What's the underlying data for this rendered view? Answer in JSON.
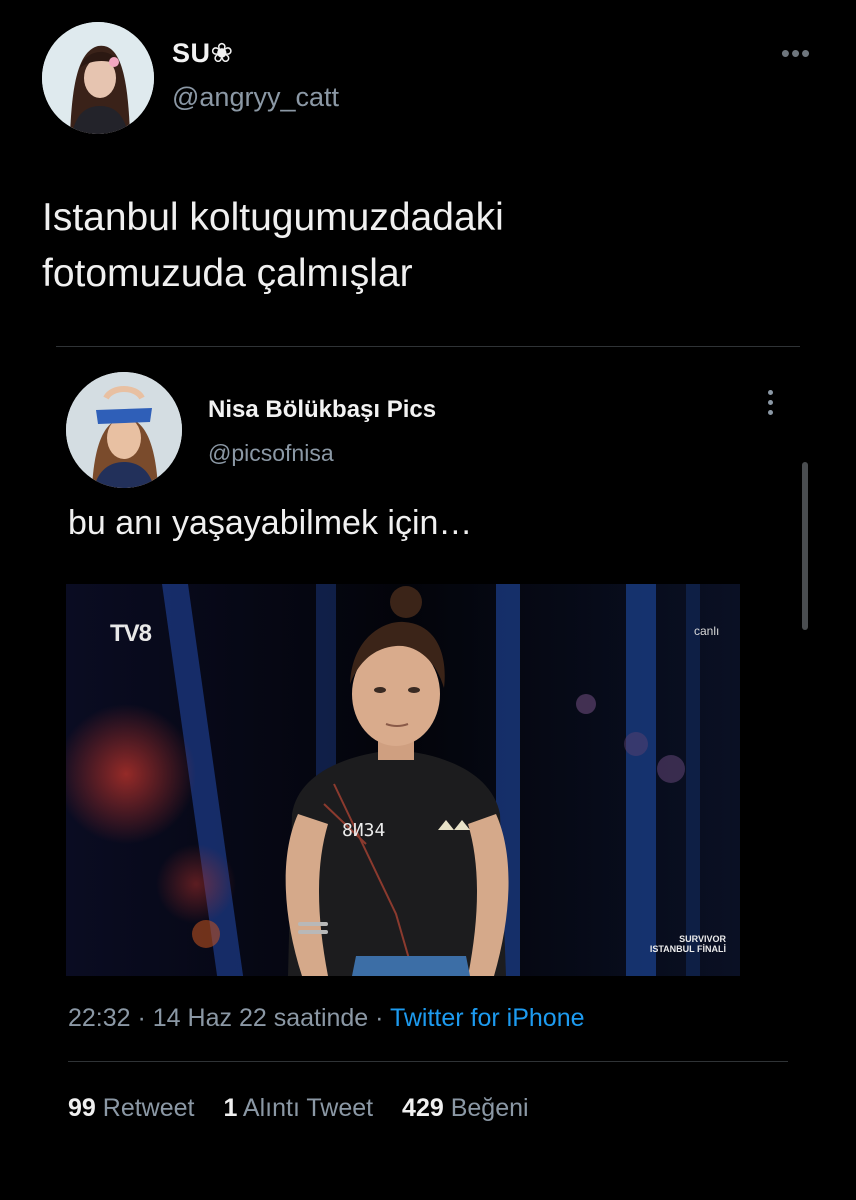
{
  "tweet": {
    "author_name": "SU❀",
    "author_handle": "@angryy_catt",
    "more_icon": "more-horizontal-icon",
    "text_line1": "Istanbul koltugumuzdadaki",
    "text_line2": "fotomuzuda çalmışlar"
  },
  "quoted_tweet": {
    "author_name": "Nisa Bölükbaşı Pics",
    "author_handle": "@picsofnisa",
    "more_icon": "more-vertical-icon",
    "text": "bu anı yaşayabilmek için…",
    "media": {
      "channel_logo": "TV8",
      "live_label": "canlı",
      "shirt_number": "8ИЗ4",
      "show_line1": "SURVIVOR",
      "show_line2": "ISTANBUL FİNALİ"
    }
  },
  "meta": {
    "time": "22:32",
    "sep1": " · ",
    "date": "14 Haz 22 saatinde",
    "sep2": " · ",
    "source": "Twitter for iPhone"
  },
  "stats": {
    "retweets_count": "99",
    "retweets_label": "Retweet",
    "quotes_count": "1",
    "quotes_label": "Alıntı Tweet",
    "likes_count": "429",
    "likes_label": "Beğeni"
  },
  "colors": {
    "background": "#000000",
    "primary_text": "#e7e9ea",
    "secondary_text": "#8b98a5",
    "link": "#1d9bf0",
    "divider": "#2f3336"
  }
}
